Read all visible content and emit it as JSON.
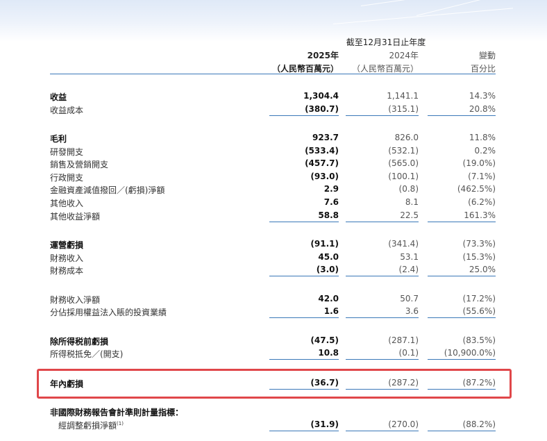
{
  "header": {
    "period": "截至12月31日止年度",
    "col_2025": "2025年",
    "col_2024": "2024年",
    "col_change": "變動",
    "unit_2025": "（人民幣百萬元）",
    "unit_2024": "（人民幣百萬元）",
    "unit_change": "百分比"
  },
  "rows": [
    {
      "label": "收益",
      "v2025": "1,304.4",
      "v2024": "1,141.1",
      "change": "14.3%"
    },
    {
      "label": "收益成本",
      "v2025": "(380.7)",
      "v2024": "(315.1)",
      "change": "20.8%"
    },
    {
      "label": "毛利",
      "v2025": "923.7",
      "v2024": "826.0",
      "change": "11.8%"
    },
    {
      "label": "研發開支",
      "v2025": "(533.4)",
      "v2024": "(532.1)",
      "change": "0.2%"
    },
    {
      "label": "銷售及營銷開支",
      "v2025": "(457.7)",
      "v2024": "(565.0)",
      "change": "(19.0%)"
    },
    {
      "label": "行政開支",
      "v2025": "(93.0)",
      "v2024": "(100.1)",
      "change": "(7.1%)"
    },
    {
      "label": "金融資產減值撥回／(虧損)淨額",
      "v2025": "2.9",
      "v2024": "(0.8)",
      "change": "(462.5%)"
    },
    {
      "label": "其他收入",
      "v2025": "7.6",
      "v2024": "8.1",
      "change": "(6.2%)"
    },
    {
      "label": "其他收益淨額",
      "v2025": "58.8",
      "v2024": "22.5",
      "change": "161.3%"
    },
    {
      "label": "運營虧損",
      "v2025": "(91.1)",
      "v2024": "(341.4)",
      "change": "(73.3%)"
    },
    {
      "label": "財務收入",
      "v2025": "45.0",
      "v2024": "53.1",
      "change": "(15.3%)"
    },
    {
      "label": "財務成本",
      "v2025": "(3.0)",
      "v2024": "(2.4)",
      "change": "25.0%"
    },
    {
      "label": "財務收入淨額",
      "v2025": "42.0",
      "v2024": "50.7",
      "change": "(17.2%)"
    },
    {
      "label": "分佔採用權益法入賬的投資業績",
      "v2025": "1.6",
      "v2024": "3.6",
      "change": "(55.6%)"
    },
    {
      "label": "除所得税前虧損",
      "v2025": "(47.5)",
      "v2024": "(287.1)",
      "change": "(83.5%)"
    },
    {
      "label": "所得税抵免／(開支)",
      "v2025": "10.8",
      "v2024": "(0.1)",
      "change": "(10,900.0%)"
    },
    {
      "label": "年內虧損",
      "v2025": "(36.7)",
      "v2024": "(287.2)",
      "change": "(87.2%)"
    },
    {
      "label": "非國際財務報告會計準則計量指標：",
      "v2025": "",
      "v2024": "",
      "change": ""
    },
    {
      "label": "經調整虧損淨額",
      "footnote": "(1)",
      "v2025": "(31.9)",
      "v2024": "(270.0)",
      "change": "(88.2%)"
    }
  ],
  "colors": {
    "rule": "#3a78b8",
    "highlight": "#e0474a",
    "header_bg": "#dfe9f7"
  }
}
